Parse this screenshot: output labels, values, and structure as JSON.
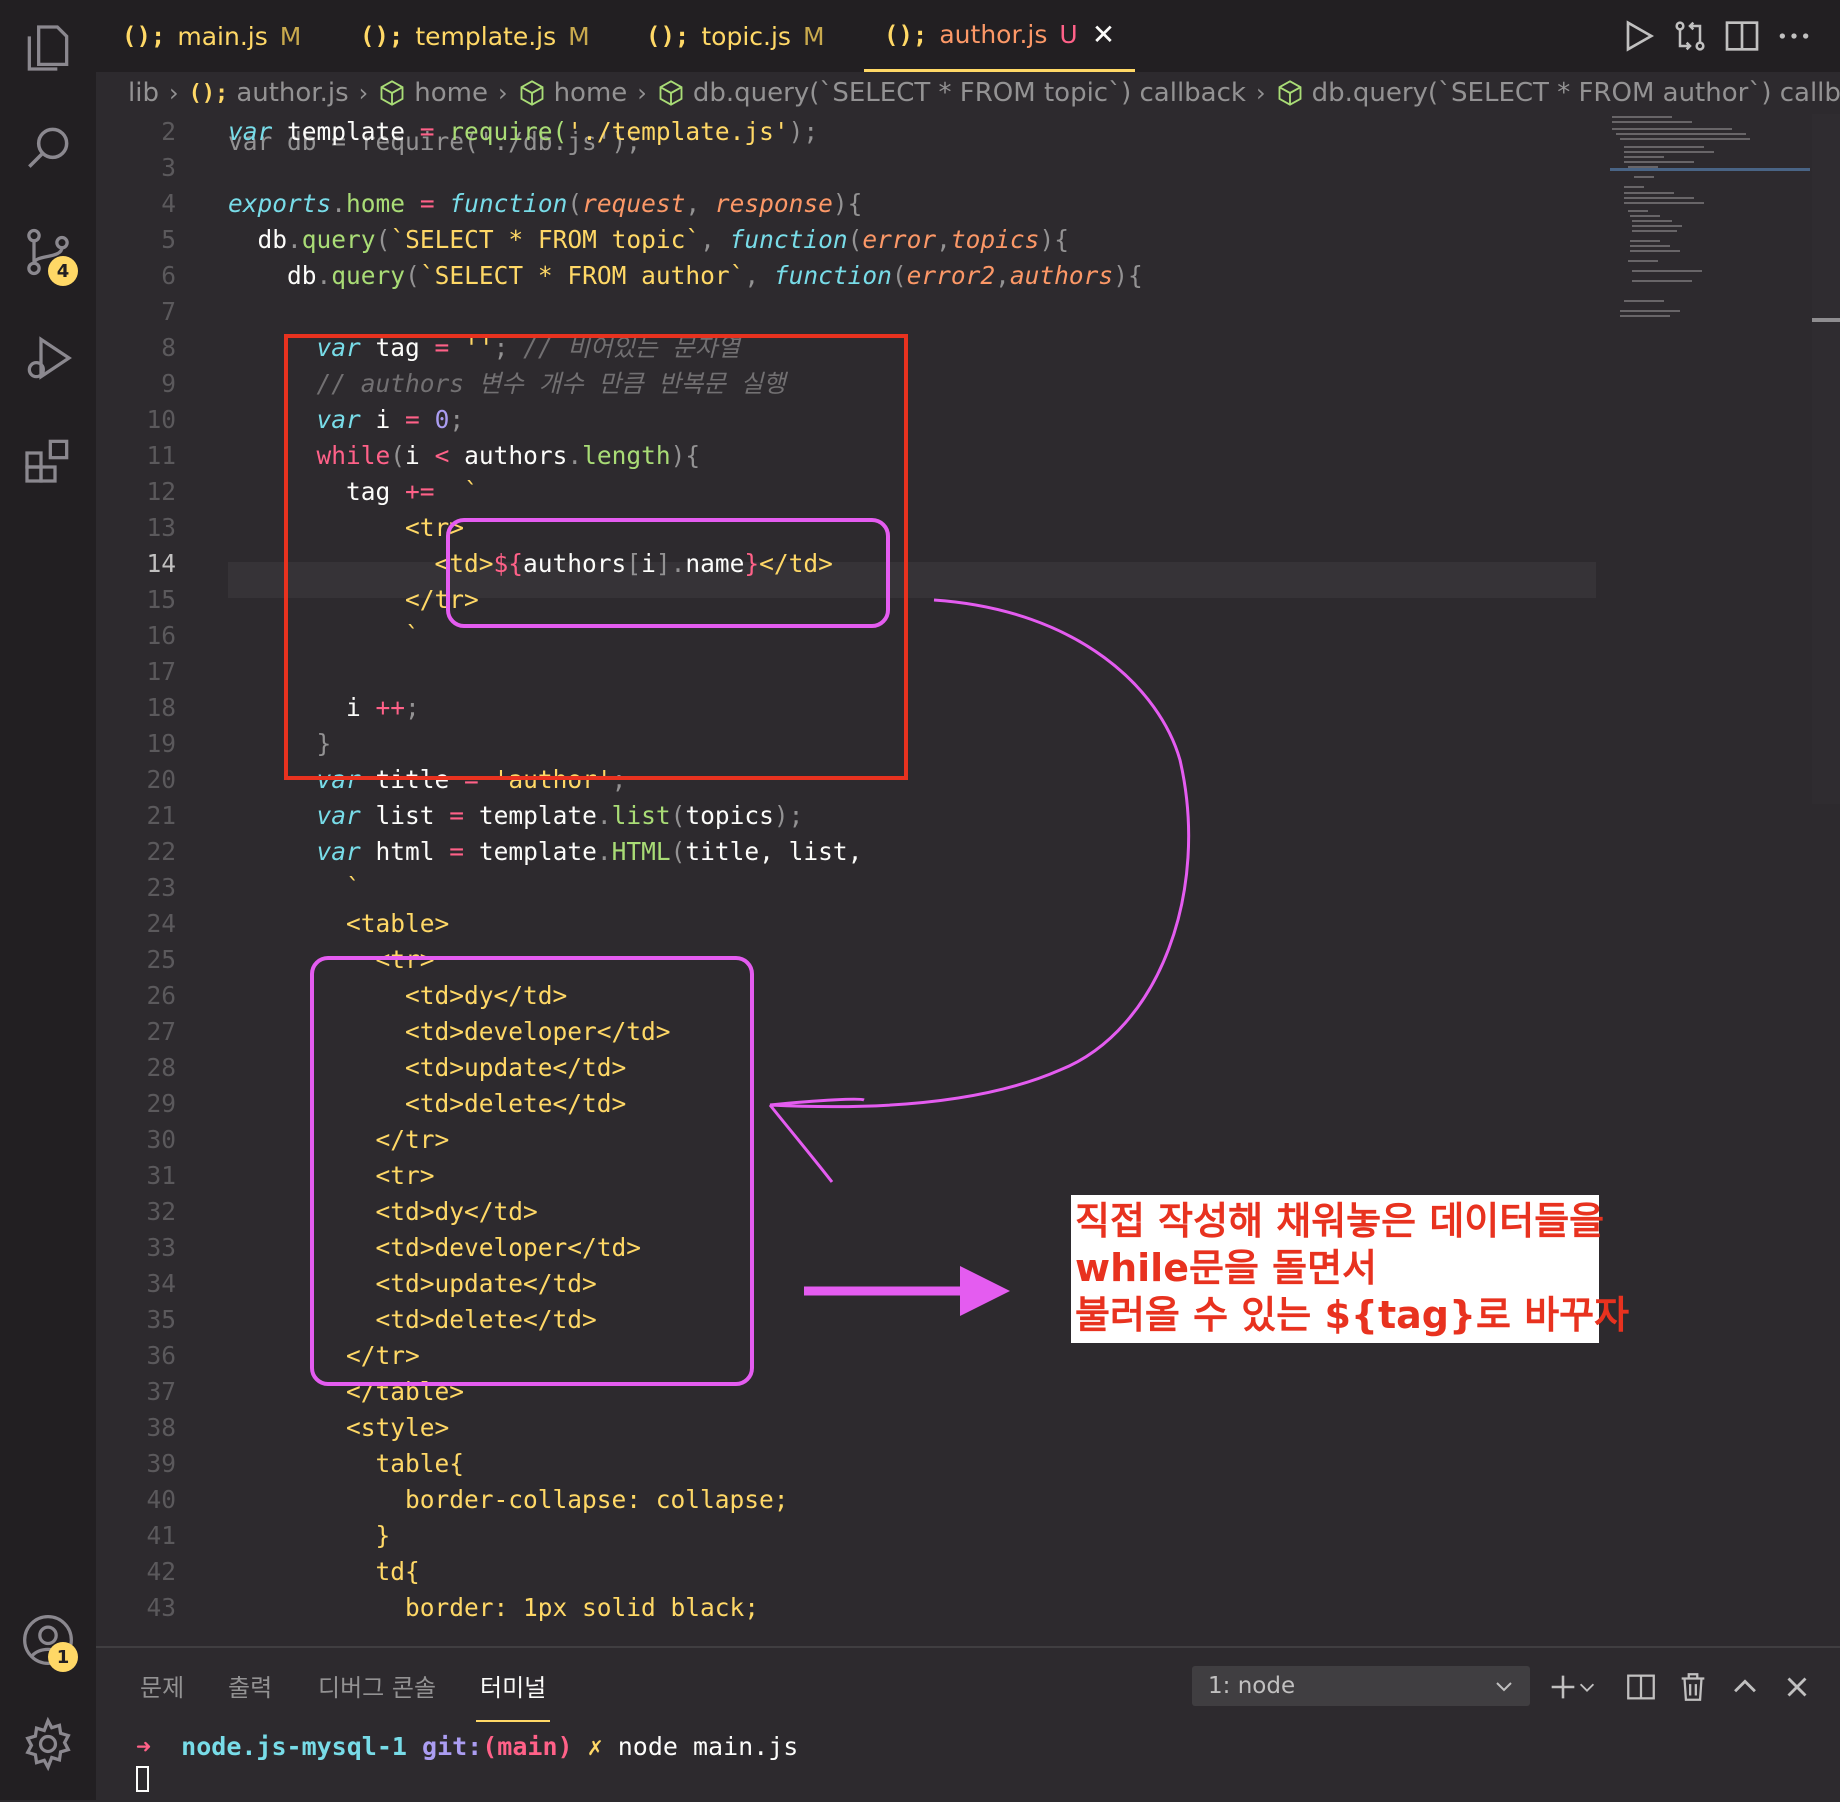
{
  "tabs": [
    {
      "icon": "{}",
      "name": "main.js",
      "status": "M"
    },
    {
      "icon": "{}",
      "name": "template.js",
      "status": "M"
    },
    {
      "icon": "{}",
      "name": "topic.js",
      "status": "M"
    },
    {
      "icon": "{}",
      "name": "author.js",
      "status": "U",
      "active": true
    }
  ],
  "tab_icon_text": "();",
  "breadcrumb": {
    "folder": "lib",
    "file": "author.js",
    "symbols": [
      "home",
      "home",
      "db.query(`SELECT * FROM topic`) callback",
      "db.query(`SELECT * FROM author`) callback"
    ]
  },
  "badges": {
    "source_control": "4",
    "accounts": "1"
  },
  "current_line": 14,
  "code": {
    "line_numbers": [
      "2",
      "3",
      "4",
      "5",
      "6",
      "7",
      "8",
      "9",
      "10",
      "11",
      "12",
      "13",
      "14",
      "15",
      "16",
      "17",
      "18",
      "19",
      "20",
      "21",
      "22",
      "23",
      "24",
      "25",
      "26",
      "27",
      "28",
      "29",
      "30",
      "31",
      "32",
      "33",
      "34",
      "35",
      "36",
      "37",
      "38",
      "39",
      "40",
      "41",
      "42",
      "43"
    ],
    "line1_partial": "var db = require('./db.js');",
    "line2": {
      "kw": "var",
      "a": " template ",
      "op": "=",
      "b": " require(",
      "s": "'./template.js'",
      "c": ");"
    },
    "line4": {
      "a": "exports",
      "dot": ".",
      "fn": "home",
      "sp": " ",
      "op": "=",
      "fkw": "function",
      "p1": "request",
      "p2": "response"
    },
    "line5": {
      "a": "db",
      "fn": "query",
      "s": "`SELECT * FROM topic`",
      "fkw": "function",
      "p1": "error",
      "p2": "topics"
    },
    "line6": {
      "a": "db",
      "fn": "query",
      "s": "`SELECT * FROM author`",
      "fkw": "function",
      "p1": "error2",
      "p2": "authors"
    },
    "line8": {
      "kw": "var",
      "a": " tag ",
      "op": "=",
      "s": " ''",
      "semi": ";",
      "comment": " // 비어있는 문자열"
    },
    "line9": {
      "comment": "// authors 변수 개수 만큼 반복문 실행"
    },
    "line10": {
      "kw": "var",
      "a": " i ",
      "op": "=",
      "num": " 0",
      "semi": ";"
    },
    "line11": {
      "k": "while",
      "a": "i ",
      "op": "<",
      "b": " authors",
      "prop": "length"
    },
    "line12": {
      "a": "tag ",
      "op": "+=",
      "s": "  `"
    },
    "line13": "<tr>",
    "line14": {
      "t1": "<td>",
      "t2": "${",
      "a": "authors",
      "b": "i",
      "c": "name",
      "t3": "}",
      "t4": "</td>"
    },
    "line15": "</tr>",
    "line16": "`",
    "line18": {
      "a": "i ",
      "op": "++",
      "semi": ";"
    },
    "line19": "}",
    "line20": {
      "kw": "var",
      "a": " title ",
      "op": "=",
      "s": " 'author'",
      "semi": ";"
    },
    "line21": {
      "kw": "var",
      "a": " list ",
      "op": "=",
      "b": " template",
      "fn": "list",
      "c": "topics",
      "semi": ";"
    },
    "line22": {
      "kw": "var",
      "a": " html ",
      "op": "=",
      "b": " template",
      "fn": "HTML",
      "c": "title, list,"
    },
    "line23": "`",
    "html_lines": {
      "24": "<table>",
      "25": "<tr>",
      "26": "<td>dy</td>",
      "27": "<td>developer</td>",
      "28": "<td>update</td>",
      "29": "<td>delete</td>",
      "30": "</tr>",
      "31": "<tr>",
      "32": "<td>dy</td>",
      "33": "<td>developer</td>",
      "34": "<td>update</td>",
      "35": "<td>delete</td>",
      "36": "</tr>",
      "37": "</table>",
      "38": "<style>",
      "39": "table{",
      "40": "border-collapse: collapse;",
      "41": "}",
      "42": "td{",
      "43": "border: 1px solid black;"
    }
  },
  "annotation": {
    "lines": [
      "직접 작성해 채워놓은 데이터들을",
      "while문을 돌면서",
      "불러올 수 있는 ${tag}로 바꾸자"
    ],
    "note_color": "#e8321f",
    "box_red": "#e8321f",
    "box_magenta": "#e45cf0"
  },
  "panel": {
    "tabs": [
      "문제",
      "출력",
      "디버그 콘솔",
      "터미널"
    ],
    "active_tab": "터미널",
    "terminal_select": "1: node",
    "prompt_arrow": "➜",
    "dir": "node.js-mysql-1",
    "git": "git:",
    "branch": "(main)",
    "dirty": "✗",
    "command": "node main.js"
  },
  "colors": {
    "background": "#2d2a2e",
    "accent": "#ffd866",
    "keyword": "#ff6188",
    "string": "#ffd866",
    "function": "#a9dc76",
    "type": "#78dce8"
  }
}
